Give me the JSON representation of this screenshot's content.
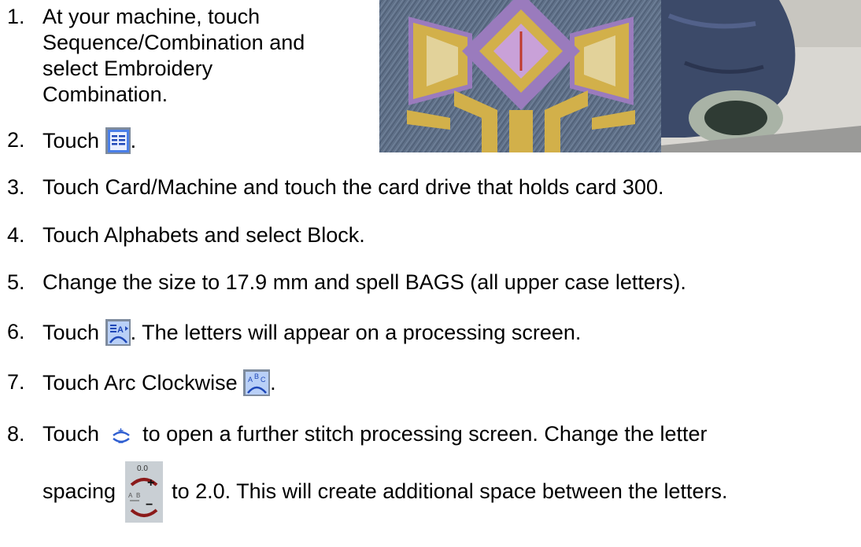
{
  "steps": [
    {
      "num": "1.",
      "lines": [
        "At your machine, touch",
        "Sequence/Combination and",
        "select Embroidery",
        "Combination."
      ]
    },
    {
      "num": "2.",
      "pre": "Touch",
      "icon": "list-icon",
      "post": "."
    },
    {
      "num": "3.",
      "text": "Touch Card/Machine and touch the card drive that holds card 300."
    },
    {
      "num": "4.",
      "text": "Touch Alphabets and select Block."
    },
    {
      "num": "5.",
      "text": "Change the size to 17.9 mm and spell BAGS (all upper case letters)."
    },
    {
      "num": "6.",
      "pre": "Touch",
      "icon": "letters-to-processing-icon",
      "post": ".  The letters will appear on a processing screen."
    },
    {
      "num": "7.",
      "pre": "Touch Arc Clockwise",
      "icon": "arc-clockwise-icon",
      "post": "."
    },
    {
      "num": "8.",
      "pre": "Touch",
      "icon": "stitch-processing-icon",
      "post": " to open a further stitch processing screen.  Change the letter",
      "line2_pre": "spacing",
      "line2_icon": "letter-spacing-icon",
      "line2_icon_value": "0.0",
      "line2_post": " to 2.0.  This will create additional space between the letters."
    }
  ],
  "images": [
    {
      "name": "embroidered-cap-closeup-photo"
    },
    {
      "name": "cap-in-hoop-photo"
    }
  ],
  "colors": {
    "denim": "#5f7088",
    "embroidery_gold": "#d2b04a",
    "embroidery_purple": "#9a7bbd",
    "icon_blue": "#2f5fd1",
    "icon_red": "#8b1a1a"
  }
}
